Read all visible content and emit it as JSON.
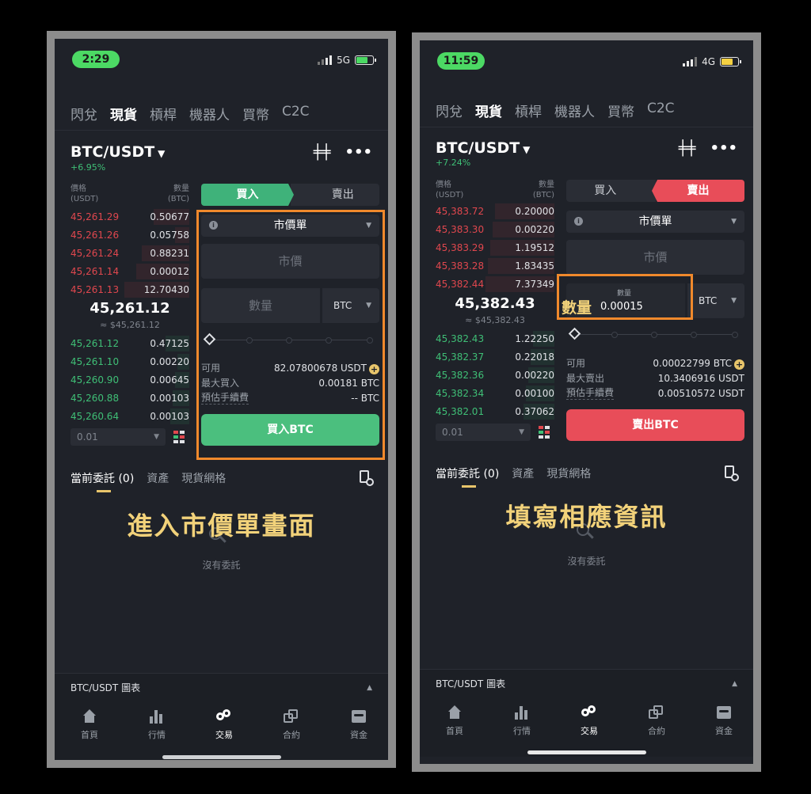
{
  "screens": [
    {
      "time": "2:29",
      "network": "5G",
      "tabs": [
        "閃兌",
        "現貨",
        "槓桿",
        "機器人",
        "買幣",
        "C2C"
      ],
      "pair": "BTC/USDT",
      "change": "+6.95%",
      "ob_header": {
        "price": "價格",
        "price_unit": "(USDT)",
        "qty": "數量",
        "qty_unit": "(BTC)"
      },
      "asks": [
        {
          "price": "45,261.29",
          "qty": "0.50677"
        },
        {
          "price": "45,261.26",
          "qty": "0.05758"
        },
        {
          "price": "45,261.24",
          "qty": "0.88231"
        },
        {
          "price": "45,261.14",
          "qty": "0.00012"
        },
        {
          "price": "45,261.13",
          "qty": "12.70430"
        }
      ],
      "last_price": "45,261.12",
      "last_fiat": "≈ $45,261.12",
      "bids": [
        {
          "price": "45,261.12",
          "qty": "0.47125"
        },
        {
          "price": "45,261.10",
          "qty": "0.00220"
        },
        {
          "price": "45,260.90",
          "qty": "0.00645"
        },
        {
          "price": "45,260.88",
          "qty": "0.00103"
        },
        {
          "price": "45,260.64",
          "qty": "0.00103"
        }
      ],
      "depth": "0.01",
      "buy_label": "買入",
      "sell_label": "賣出",
      "order_type": "市價單",
      "price_placeholder": "市價",
      "qty_placeholder": "數量",
      "qty_unit": "BTC",
      "available_label": "可用",
      "available_value": "82.07800678 USDT",
      "max_label": "最大買入",
      "max_value": "0.00181 BTC",
      "fee_label": "預估手續費",
      "fee_value": "-- BTC",
      "action": "買入BTC",
      "order_tabs": [
        "當前委託 (0)",
        "資產",
        "現貨網格"
      ],
      "overlay": "進入市價單畫面",
      "empty": "沒有委託",
      "chart_label": "BTC/USDT 圖表",
      "nav": [
        "首頁",
        "行情",
        "交易",
        "合約",
        "資金"
      ]
    },
    {
      "time": "11:59",
      "network": "4G",
      "tabs": [
        "閃兌",
        "現貨",
        "槓桿",
        "機器人",
        "買幣",
        "C2C"
      ],
      "pair": "BTC/USDT",
      "change": "+7.24%",
      "ob_header": {
        "price": "價格",
        "price_unit": "(USDT)",
        "qty": "數量",
        "qty_unit": "(BTC)"
      },
      "asks": [
        {
          "price": "45,383.72",
          "qty": "0.20000"
        },
        {
          "price": "45,383.30",
          "qty": "0.00220"
        },
        {
          "price": "45,383.29",
          "qty": "1.19512"
        },
        {
          "price": "45,383.28",
          "qty": "1.83435"
        },
        {
          "price": "45,382.44",
          "qty": "7.37349"
        }
      ],
      "last_price": "45,382.43",
      "last_fiat": "≈ $45,382.43",
      "bids": [
        {
          "price": "45,382.43",
          "qty": "1.22250"
        },
        {
          "price": "45,382.37",
          "qty": "0.22018"
        },
        {
          "price": "45,382.36",
          "qty": "0.00220"
        },
        {
          "price": "45,382.34",
          "qty": "0.00100"
        },
        {
          "price": "45,382.01",
          "qty": "0.37062"
        }
      ],
      "depth": "0.01",
      "buy_label": "買入",
      "sell_label": "賣出",
      "order_type": "市價單",
      "price_placeholder": "市價",
      "qty_small_label": "數量",
      "qty_big_label": "數量",
      "qty_value": "0.00015",
      "qty_unit": "BTC",
      "available_label": "可用",
      "available_value": "0.00022799 BTC",
      "max_label": "最大賣出",
      "max_value": "10.3406916 USDT",
      "fee_label": "預估手續費",
      "fee_value": "0.00510572 USDT",
      "action": "賣出BTC",
      "order_tabs": [
        "當前委託 (0)",
        "資產",
        "現貨網格"
      ],
      "overlay": "填寫相應資訊",
      "empty": "沒有委託",
      "chart_label": "BTC/USDT 圖表",
      "nav": [
        "首頁",
        "行情",
        "交易",
        "合約",
        "資金"
      ]
    }
  ],
  "colors": {
    "background": "#1f2229",
    "buy_green": "#4bbf7e",
    "sell_red": "#e84d59",
    "highlight_orange": "#f0892c",
    "caption_yellow": "#f2d27a"
  }
}
